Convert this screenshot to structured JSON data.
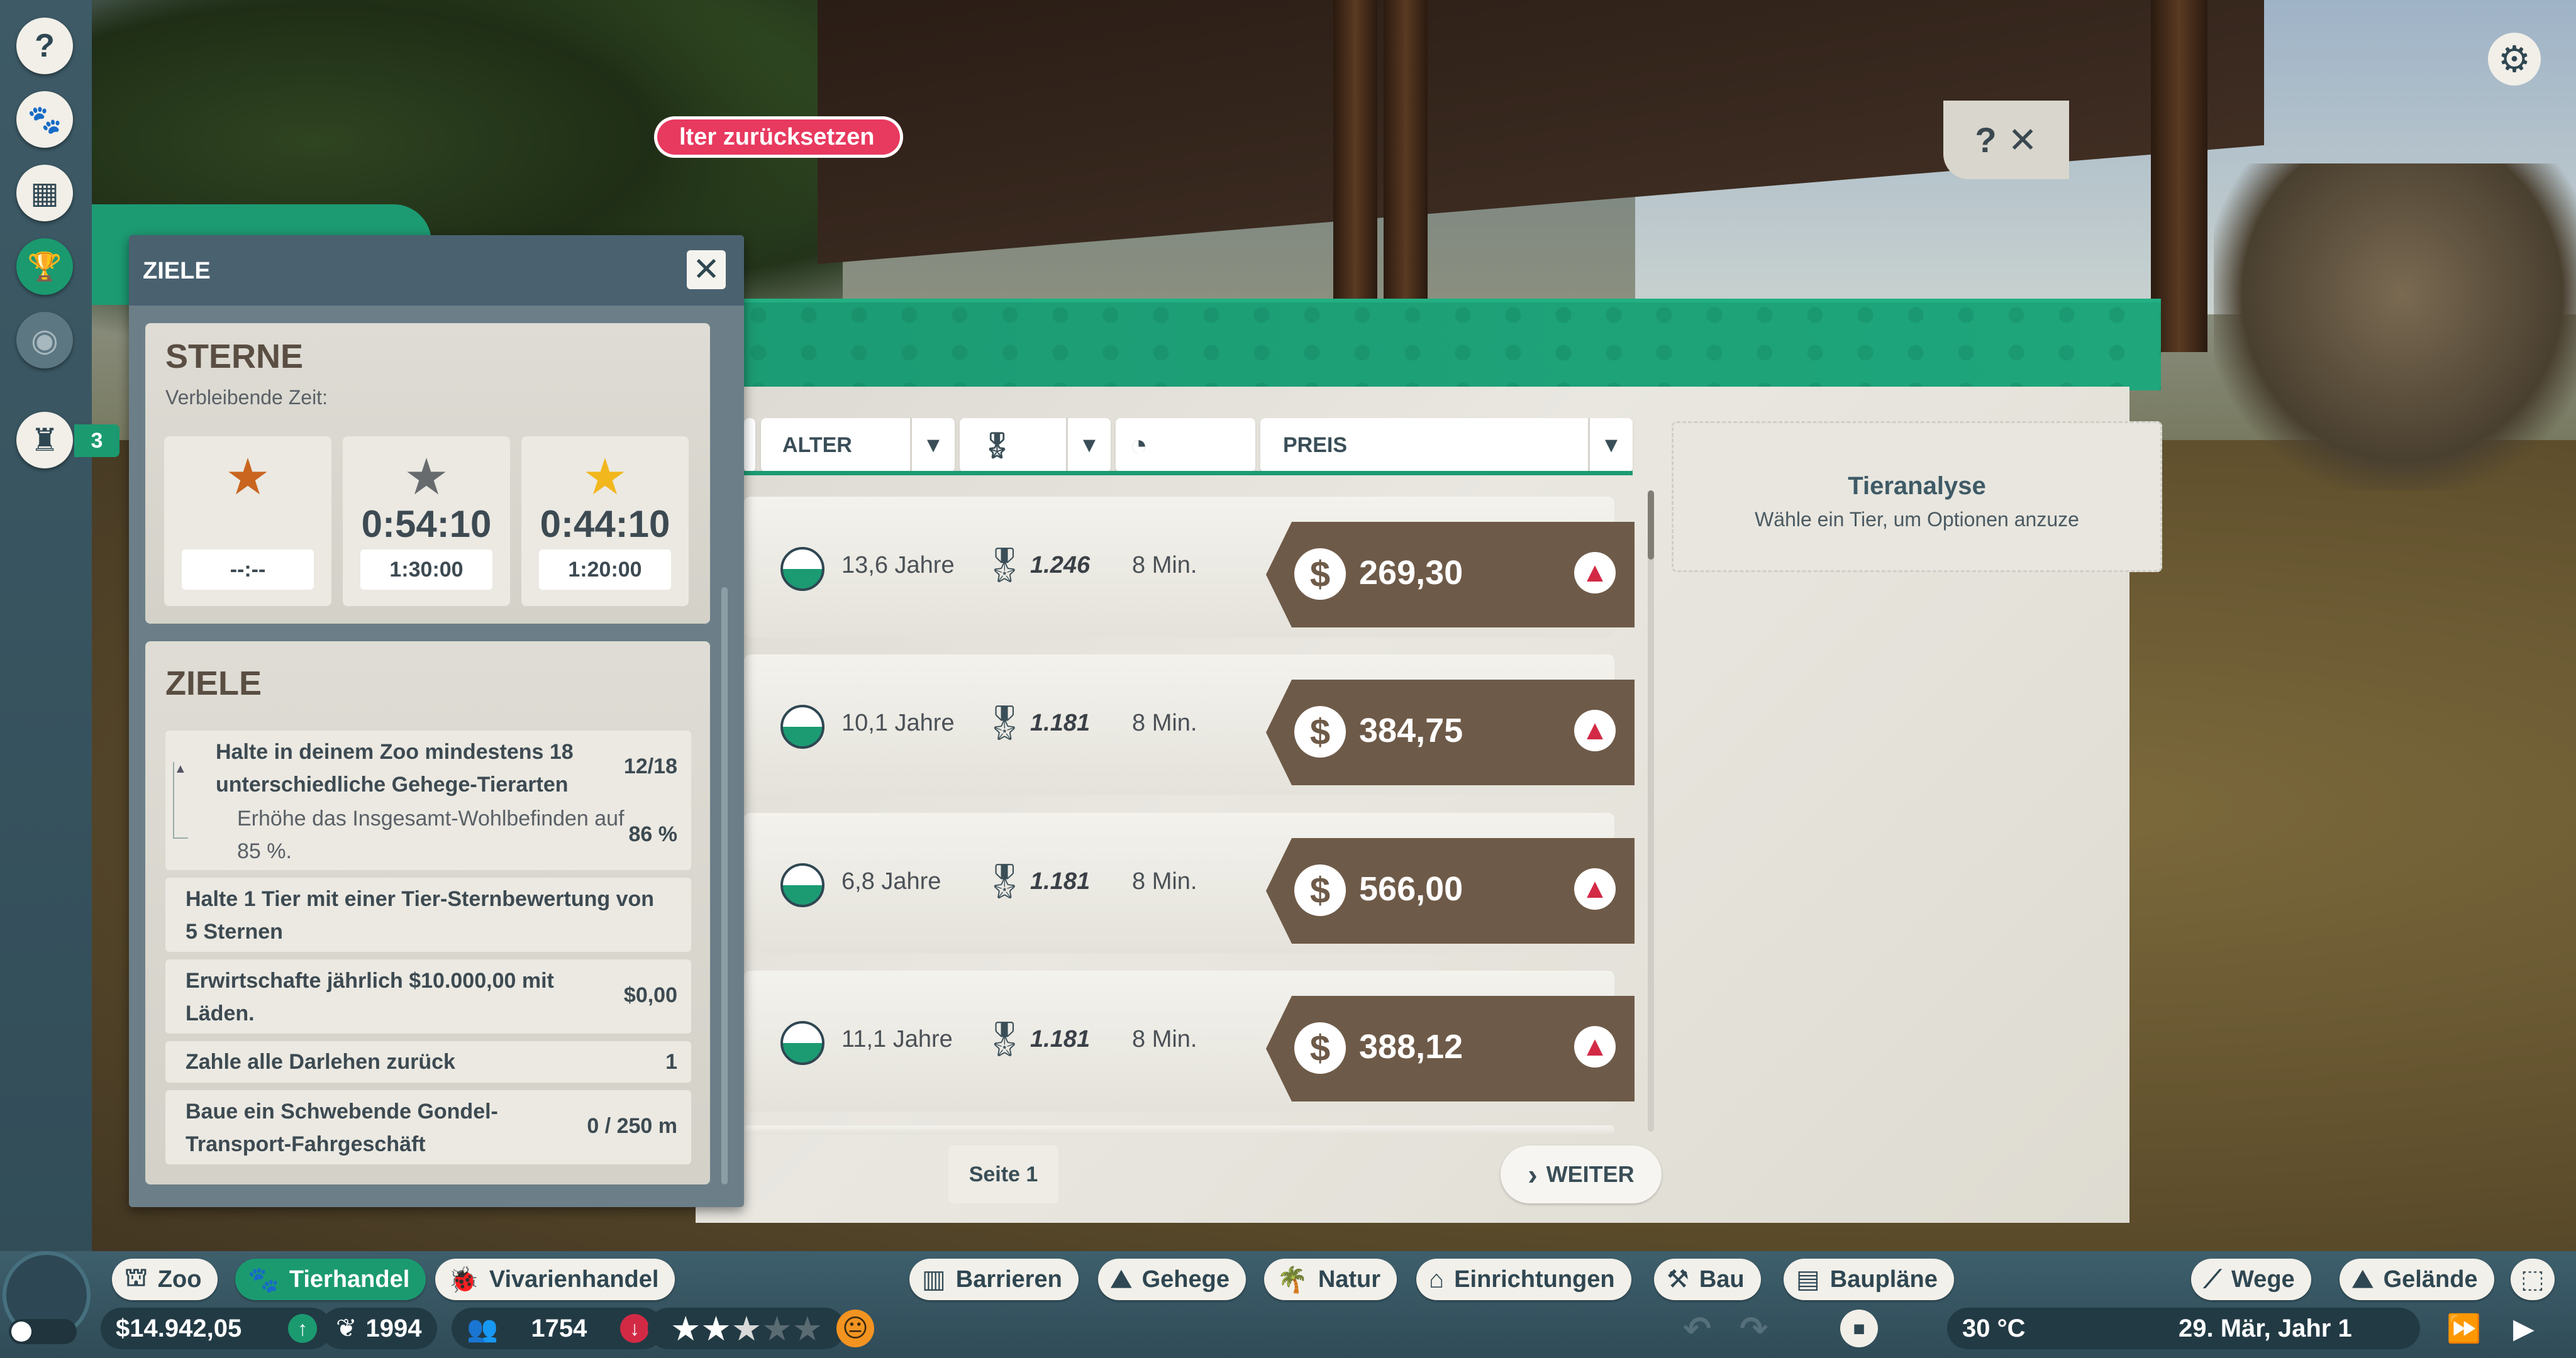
{
  "sidebar": {
    "items": [
      {
        "icon": "question-icon",
        "glyph": "?"
      },
      {
        "icon": "animal-card-icon",
        "glyph": "🐾"
      },
      {
        "icon": "calendar-icon",
        "glyph": "▦"
      },
      {
        "icon": "trophy-icon",
        "glyph": "🏆"
      },
      {
        "icon": "eye-icon",
        "glyph": "◉"
      },
      {
        "icon": "staff-icon",
        "glyph": "♜"
      }
    ],
    "staff_badge": "3"
  },
  "market": {
    "reset_filter_label": "lter zurücksetzen",
    "help_glyph": "?",
    "close_glyph": "✕",
    "columns": {
      "alter": "ALTER",
      "preis": "PREIS"
    },
    "rows": [
      {
        "age": "13,6 Jahre",
        "score": "1.246",
        "time": "8 Min.",
        "price": "269,30"
      },
      {
        "age": "10,1 Jahre",
        "score": "1.181",
        "time": "8 Min.",
        "price": "384,75"
      },
      {
        "age": "6,8 Jahre",
        "score": "1.181",
        "time": "8 Min.",
        "price": "566,00"
      },
      {
        "age": "11,1 Jahre",
        "score": "1.181",
        "time": "8 Min.",
        "price": "388,12"
      }
    ],
    "page_label": "Seite 1",
    "next_label": "WEITER",
    "analysis": {
      "title": "Tieranalyse",
      "subtitle": "Wähle ein Tier, um Optionen anzuze"
    }
  },
  "goals": {
    "panel_title": "ZIELE",
    "stars": {
      "heading": "STERNE",
      "remaining_label": "Verbleibende Zeit:",
      "boxes": [
        {
          "tier": "bronze",
          "color": "#c9651f",
          "time": "",
          "limit": "--:--"
        },
        {
          "tier": "silver",
          "color": "#676b6e",
          "time": "0:54:10",
          "limit": "1:30:00"
        },
        {
          "tier": "gold",
          "color": "#f2b71d",
          "time": "0:44:10",
          "limit": "1:20:00"
        }
      ]
    },
    "list": {
      "heading": "ZIELE",
      "items": [
        {
          "text": "Halte in deinem Zoo mindestens 18 unterschiedliche Gehege-Tierarten",
          "value": "12/18",
          "sub_text": "Erhöhe das Insgesamt-Wohlbefinden auf 85 %.",
          "sub_value": "86 %"
        },
        {
          "text": "Halte 1 Tier mit einer Tier-Sternbewertung von 5 Sternen",
          "value": ""
        },
        {
          "text": "Erwirtschafte jährlich $10.000,00 mit Läden.",
          "value": "$0,00"
        },
        {
          "text": "Zahle alle Darlehen zurück",
          "value": "1"
        },
        {
          "text": "Baue ein Schwebende Gondel-Transport-Fahrgeschäft",
          "value": "0 / 250 m"
        }
      ]
    }
  },
  "bottombar": {
    "tabs": [
      {
        "label": "Zoo",
        "icon": "zoo-icon",
        "glyph": "⛫",
        "active": false
      },
      {
        "label": "Tierhandel",
        "icon": "paw-icon",
        "glyph": "🐾",
        "active": true
      },
      {
        "label": "Vivarienhandel",
        "icon": "bug-icon",
        "glyph": "🐞",
        "active": false
      },
      {
        "label": "Barrieren",
        "icon": "fence-icon",
        "glyph": "▥",
        "active": false
      },
      {
        "label": "Gehege",
        "icon": "habitat-icon",
        "glyph": "⛰",
        "active": false
      },
      {
        "label": "Natur",
        "icon": "tree-icon",
        "glyph": "🌴",
        "active": false
      },
      {
        "label": "Einrichtungen",
        "icon": "facility-icon",
        "glyph": "⌂",
        "active": false
      },
      {
        "label": "Bau",
        "icon": "crane-icon",
        "glyph": "⚒",
        "active": false
      },
      {
        "label": "Baupläne",
        "icon": "blueprint-icon",
        "glyph": "▤",
        "active": false
      },
      {
        "label": "Wege",
        "icon": "path-icon",
        "glyph": "⟋",
        "active": false
      },
      {
        "label": "Gelände",
        "icon": "terrain-icon",
        "glyph": "⛰",
        "active": false
      }
    ],
    "money": "$14.942,05",
    "conservation": "1994",
    "guests": "1754",
    "rating_stars": 2.5,
    "temperature": "30 °C",
    "date": "29. Mär, Jahr 1"
  }
}
